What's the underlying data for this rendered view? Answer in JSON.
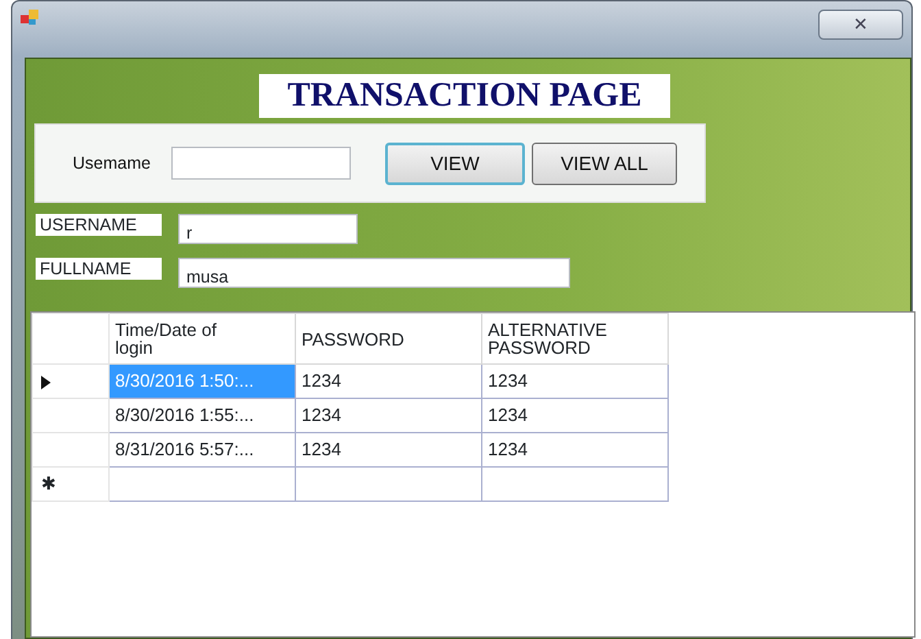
{
  "window": {
    "close": "✕"
  },
  "title": "TRANSACTION PAGE",
  "search": {
    "label": "Usemame",
    "buttons": [
      {
        "label": "VIEW",
        "focused": true
      },
      {
        "label": "VIEW ALL",
        "focused": false
      }
    ]
  },
  "fields": [
    {
      "label": "USERNAME",
      "value": "r",
      "wide": false
    },
    {
      "label": "FULLNAME",
      "value": "musa",
      "wide": true
    }
  ],
  "table": {
    "columns": [
      "Time/Date of login",
      "PASSWORD",
      "ALTERNATIVE PASSWORD"
    ],
    "rows": [
      {
        "selected": true,
        "cells": [
          "8/30/2016 1:50:...",
          "1234",
          "1234"
        ]
      },
      {
        "selected": false,
        "cells": [
          "8/30/2016 1:55:...",
          "1234",
          "1234"
        ]
      },
      {
        "selected": false,
        "cells": [
          "8/31/2016 5:57:...",
          "1234",
          "1234"
        ]
      }
    ],
    "new_row_marker": "✱"
  }
}
